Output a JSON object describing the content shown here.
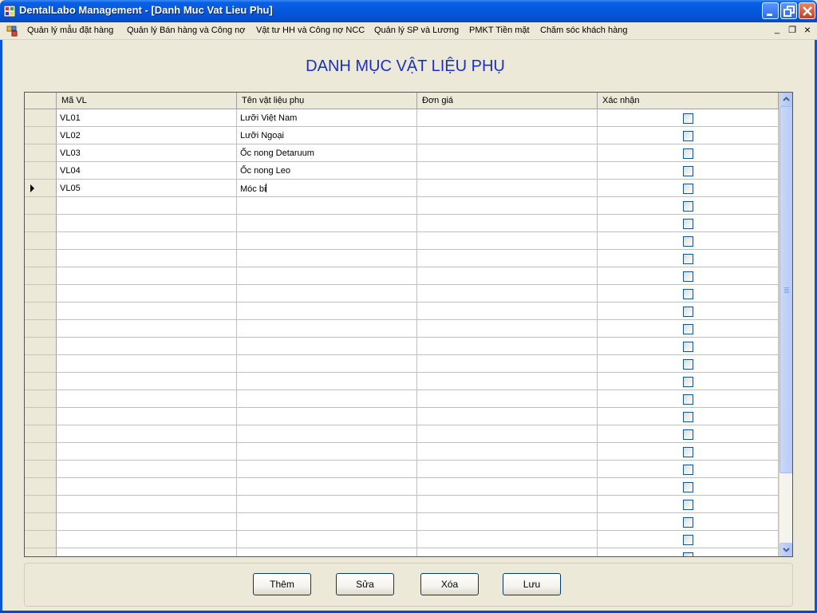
{
  "window": {
    "title": "DentalLabo Management - [Danh Muc Vat Lieu Phu]"
  },
  "menu": {
    "items": [
      "Quản lý mẫu đặt hàng",
      "Quản lý Bán hàng và Công nợ",
      "Vật tư HH và Công nợ NCC",
      "Quản lý SP và Lương",
      "PMKT Tiền mặt",
      "Chăm sóc khách hàng"
    ],
    "mdi_minimize": "_",
    "mdi_restore": "❐",
    "mdi_close": "×"
  },
  "heading": "DANH MỤC VẬT LIỆU PHỤ",
  "grid": {
    "columns": [
      "Mã VL",
      "Tên vật liệu phụ",
      "Đơn giá",
      "Xác nhận"
    ],
    "rows": [
      {
        "code": "VL01",
        "name": "Lưỡi Việt Nam",
        "price": "",
        "confirmed": false
      },
      {
        "code": "VL02",
        "name": "Lưỡi Ngoại",
        "price": "",
        "confirmed": false
      },
      {
        "code": "VL03",
        "name": "Ốc nong Detaruum",
        "price": "",
        "confirmed": false
      },
      {
        "code": "VL04",
        "name": "Ốc nong Leo",
        "price": "",
        "confirmed": false
      },
      {
        "code": "VL05",
        "name": "Móc bi",
        "price": "",
        "confirmed": false
      }
    ],
    "current_row": 4,
    "empty_rows": 21
  },
  "buttons": {
    "add": "Thêm",
    "edit": "Sửa",
    "delete": "Xóa",
    "save": "Lưu"
  },
  "colors": {
    "heading": "#1a2fc8",
    "titlebar": "#0558dc"
  }
}
